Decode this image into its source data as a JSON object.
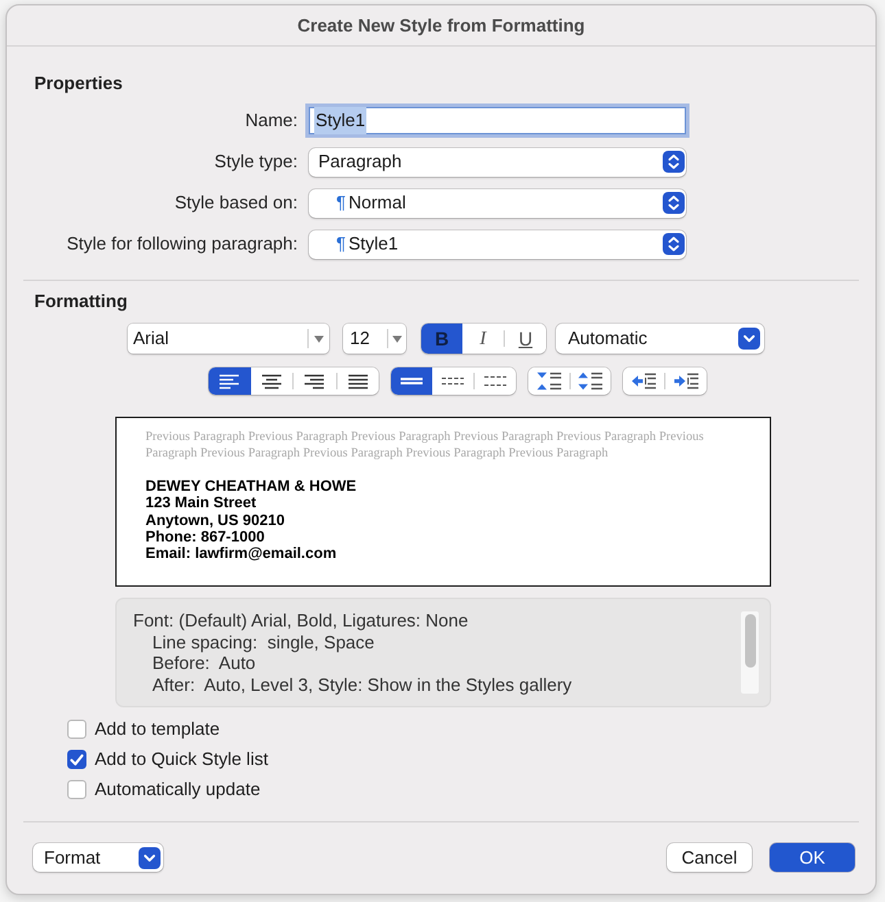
{
  "window": {
    "title": "Create New Style from Formatting"
  },
  "properties": {
    "heading": "Properties",
    "fields": [
      {
        "kind": "text",
        "label": "Name:",
        "value": "Style1",
        "focused": true
      },
      {
        "kind": "popup",
        "label": "Style type:",
        "value": "Paragraph"
      },
      {
        "kind": "popup",
        "label": "Style based on:",
        "symbol": "¶",
        "value": "Normal"
      },
      {
        "kind": "popup",
        "label": "Style for following paragraph:",
        "symbol": "¶",
        "value": "Style1"
      }
    ]
  },
  "formatting": {
    "heading": "Formatting",
    "font": {
      "value": "Arial"
    },
    "size": {
      "value": "12"
    },
    "text_styles": [
      {
        "kind": "bold",
        "label": "B",
        "selected": true
      },
      {
        "kind": "italic",
        "label": "I",
        "selected": false
      },
      {
        "kind": "underline",
        "label": "U",
        "selected": false
      }
    ],
    "color": {
      "value": "Automatic"
    },
    "alignment": [
      {
        "kind": "left",
        "selected": true
      },
      {
        "kind": "center",
        "selected": false
      },
      {
        "kind": "right",
        "selected": false
      },
      {
        "kind": "justify",
        "selected": false
      }
    ],
    "line_spacing": [
      {
        "kind": "single",
        "selected": true
      },
      {
        "kind": "one_and_half",
        "selected": false
      },
      {
        "kind": "double",
        "selected": false
      }
    ],
    "paragraph_spacing": [
      {
        "kind": "decrease"
      },
      {
        "kind": "increase"
      }
    ],
    "indent": [
      {
        "kind": "decrease"
      },
      {
        "kind": "increase"
      }
    ]
  },
  "preview": {
    "previous_paragraph": "Previous Paragraph Previous Paragraph Previous Paragraph Previous Paragraph Previous Paragraph Previous Paragraph Previous Paragraph Previous Paragraph Previous Paragraph Previous Paragraph",
    "lines": [
      "DEWEY CHEATHAM & HOWE",
      "123 Main Street",
      "Anytown, US 90210",
      "Phone: 867-1000",
      "Email: lawfirm@email.com"
    ]
  },
  "description": {
    "lines": [
      "Font: (Default) Arial, Bold, Ligatures: None",
      "Line spacing:  single, Space",
      "Before:  Auto",
      "After:  Auto, Level 3, Style: Show in the Styles gallery"
    ]
  },
  "options": [
    {
      "label": "Add to template",
      "checked": false
    },
    {
      "label": "Add to Quick Style list",
      "checked": true
    },
    {
      "label": "Automatically update",
      "checked": false
    }
  ],
  "footer": {
    "menu": {
      "label": "Format"
    },
    "buttons": [
      {
        "kind": "cancel",
        "label": "Cancel"
      },
      {
        "kind": "default",
        "label": "OK"
      }
    ]
  }
}
